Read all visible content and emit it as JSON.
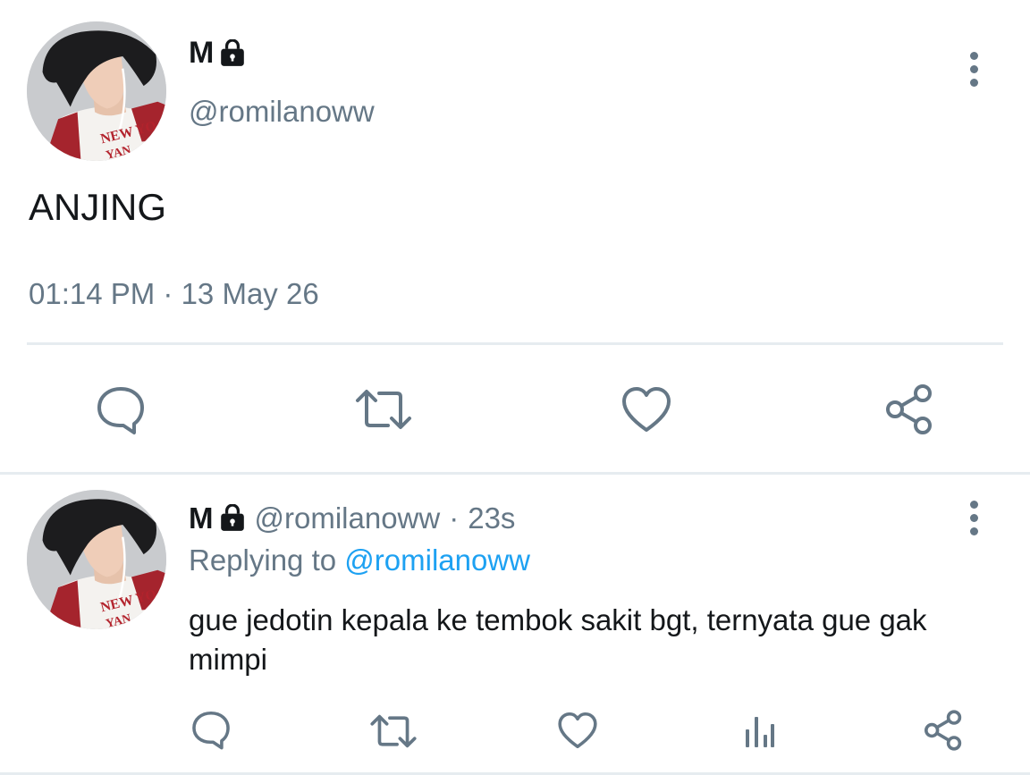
{
  "main_tweet": {
    "name": "M",
    "handle": "@romilanoww",
    "text": "ANJING",
    "timestamp": "01:14 PM · 13 May 26",
    "actions": [
      "comment-icon",
      "retweet-icon",
      "heart-icon",
      "share-icon"
    ]
  },
  "reply_tweet": {
    "name": "M",
    "handle": "@romilanoww",
    "sep": "·",
    "age": "23s",
    "replying_prefix": "Replying to",
    "replying_handle": "@romilanoww",
    "text": "gue jedotin kepala ke tembok sakit bgt, ternyata gue gak mimpi",
    "actions": [
      "comment-icon",
      "retweet-icon",
      "heart-icon",
      "analytics-icon",
      "share-icon"
    ]
  },
  "colors": {
    "text": "#14171a",
    "muted": "#657786",
    "link": "#1da1f2",
    "divider": "#e6ecf0"
  }
}
